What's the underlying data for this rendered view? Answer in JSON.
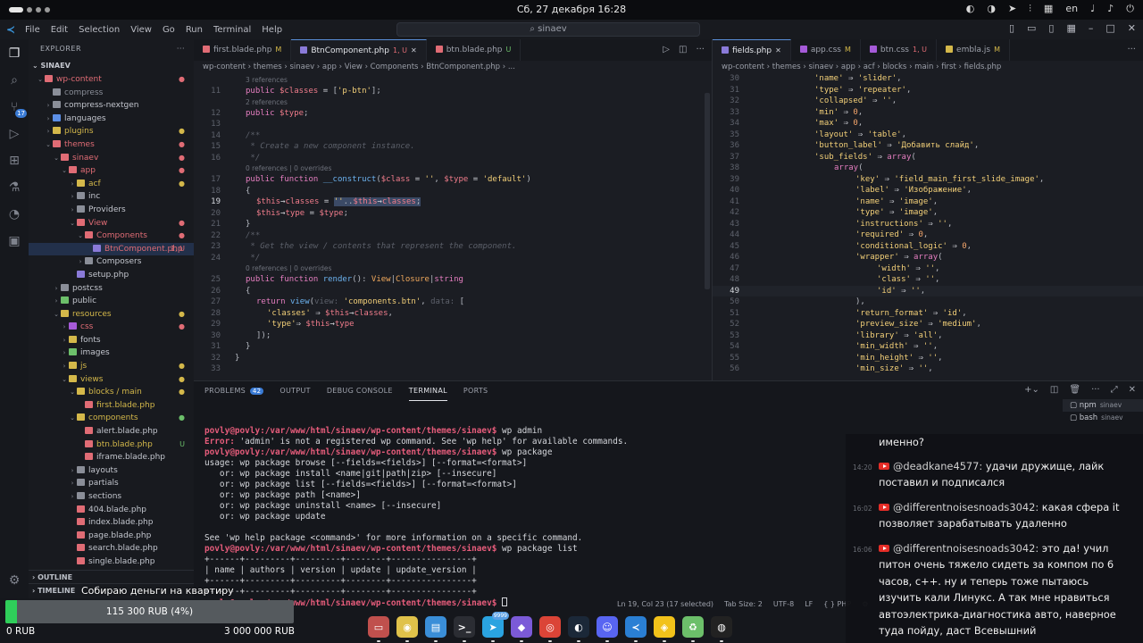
{
  "system_bar": {
    "clock": "Сб, 27 декабря 16:28",
    "lang": "en"
  },
  "titlebar": {
    "menu": [
      "File",
      "Edit",
      "Selection",
      "View",
      "Go",
      "Run",
      "Terminal",
      "Help"
    ],
    "search": "sinaev"
  },
  "explorer": {
    "title": "EXPLORER",
    "root": "SINAEV",
    "items": [
      {
        "label": "wp-content",
        "depth": 0,
        "chev": "v",
        "color": "#e06c75",
        "mark": "●",
        "markColor": "#e06c75",
        "textColor": "#e06c75"
      },
      {
        "label": "compress",
        "depth": 1,
        "chev": "",
        "color": "#8a8e98",
        "mark": "",
        "textColor": "#8a8e98"
      },
      {
        "label": "compress-nextgen",
        "depth": 1,
        "chev": ">",
        "color": "#8a8e98",
        "mark": "",
        "textColor": "#c3c6ce"
      },
      {
        "label": "languages",
        "depth": 1,
        "chev": ">",
        "color": "#5c8fe6",
        "mark": "",
        "textColor": "#c3c6ce"
      },
      {
        "label": "plugins",
        "depth": 1,
        "chev": ">",
        "color": "#d4b84a",
        "mark": "●",
        "markColor": "#d4b84a",
        "textColor": "#d4b84a"
      },
      {
        "label": "themes",
        "depth": 1,
        "chev": "v",
        "color": "#e06c75",
        "mark": "●",
        "markColor": "#e06c75",
        "textColor": "#e06c75"
      },
      {
        "label": "sinaev",
        "depth": 2,
        "chev": "v",
        "color": "#e06c75",
        "mark": "●",
        "markColor": "#e06c75",
        "textColor": "#e06c75"
      },
      {
        "label": "app",
        "depth": 3,
        "chev": "v",
        "color": "#e06c75",
        "mark": "●",
        "markColor": "#e06c75",
        "textColor": "#e06c75"
      },
      {
        "label": "acf",
        "depth": 4,
        "chev": ">",
        "color": "#d4b84a",
        "mark": "●",
        "markColor": "#d4b84a",
        "textColor": "#d4b84a"
      },
      {
        "label": "inc",
        "depth": 4,
        "chev": ">",
        "color": "#8a8e98",
        "mark": "",
        "textColor": "#c3c6ce"
      },
      {
        "label": "Providers",
        "depth": 4,
        "chev": ">",
        "color": "#8a8e98",
        "mark": "",
        "textColor": "#c3c6ce"
      },
      {
        "label": "View",
        "depth": 4,
        "chev": "v",
        "color": "#e06c75",
        "mark": "●",
        "markColor": "#e06c75",
        "textColor": "#e06c75"
      },
      {
        "label": "Components",
        "depth": 5,
        "chev": "v",
        "color": "#e06c75",
        "mark": "●",
        "markColor": "#e06c75",
        "textColor": "#e06c75"
      },
      {
        "label": "BtnComponent.php",
        "depth": 6,
        "chev": "",
        "color": "#8a7ad8",
        "mark": "1, U",
        "markColor": "#e06c75",
        "textColor": "#e06c75",
        "selected": true
      },
      {
        "label": "Composers",
        "depth": 5,
        "chev": ">",
        "color": "#8a8e98",
        "mark": "",
        "textColor": "#c3c6ce"
      },
      {
        "label": "setup.php",
        "depth": 4,
        "chev": "",
        "color": "#8a7ad8",
        "mark": "",
        "textColor": "#c3c6ce"
      },
      {
        "label": "postcss",
        "depth": 2,
        "chev": ">",
        "color": "#8a8e98",
        "mark": "",
        "textColor": "#c3c6ce"
      },
      {
        "label": "public",
        "depth": 2,
        "chev": ">",
        "color": "#6cbf6a",
        "mark": "",
        "textColor": "#c3c6ce"
      },
      {
        "label": "resources",
        "depth": 2,
        "chev": "v",
        "color": "#d4b84a",
        "mark": "●",
        "markColor": "#d4b84a",
        "textColor": "#d4b84a"
      },
      {
        "label": "css",
        "depth": 3,
        "chev": ">",
        "color": "#a55ad8",
        "mark": "●",
        "markColor": "#e06c75",
        "textColor": "#e06c75"
      },
      {
        "label": "fonts",
        "depth": 3,
        "chev": ">",
        "color": "#d4b84a",
        "mark": "",
        "textColor": "#c3c6ce"
      },
      {
        "label": "images",
        "depth": 3,
        "chev": ">",
        "color": "#6cbf6a",
        "mark": "",
        "textColor": "#c3c6ce"
      },
      {
        "label": "js",
        "depth": 3,
        "chev": ">",
        "color": "#d4b84a",
        "mark": "●",
        "markColor": "#d4b84a",
        "textColor": "#d4b84a"
      },
      {
        "label": "views",
        "depth": 3,
        "chev": "v",
        "color": "#d4b84a",
        "mark": "●",
        "markColor": "#d4b84a",
        "textColor": "#d4b84a"
      },
      {
        "label": "blocks / main",
        "depth": 4,
        "chev": "v",
        "color": "#d4b84a",
        "mark": "●",
        "markColor": "#d4b84a",
        "textColor": "#d4b84a"
      },
      {
        "label": "first.blade.php",
        "depth": 5,
        "chev": "",
        "color": "#e06c75",
        "mark": "",
        "textColor": "#d4b84a"
      },
      {
        "label": "components",
        "depth": 4,
        "chev": "v",
        "color": "#d4b84a",
        "mark": "●",
        "markColor": "#6cbf6a",
        "textColor": "#d4b84a"
      },
      {
        "label": "alert.blade.php",
        "depth": 5,
        "chev": "",
        "color": "#e06c75",
        "mark": "",
        "textColor": "#c3c6ce"
      },
      {
        "label": "btn.blade.php",
        "depth": 5,
        "chev": "",
        "color": "#e06c75",
        "mark": "U",
        "markColor": "#6cbf6a",
        "textColor": "#d4b84a"
      },
      {
        "label": "iframe.blade.php",
        "depth": 5,
        "chev": "",
        "color": "#e06c75",
        "mark": "",
        "textColor": "#c3c6ce"
      },
      {
        "label": "layouts",
        "depth": 4,
        "chev": ">",
        "color": "#8a8e98",
        "mark": "",
        "textColor": "#c3c6ce"
      },
      {
        "label": "partials",
        "depth": 4,
        "chev": ">",
        "color": "#8a8e98",
        "mark": "",
        "textColor": "#c3c6ce"
      },
      {
        "label": "sections",
        "depth": 4,
        "chev": ">",
        "color": "#8a8e98",
        "mark": "",
        "textColor": "#c3c6ce"
      },
      {
        "label": "404.blade.php",
        "depth": 4,
        "chev": "",
        "color": "#e06c75",
        "mark": "",
        "textColor": "#c3c6ce"
      },
      {
        "label": "index.blade.php",
        "depth": 4,
        "chev": "",
        "color": "#e06c75",
        "mark": "",
        "textColor": "#c3c6ce"
      },
      {
        "label": "page.blade.php",
        "depth": 4,
        "chev": "",
        "color": "#e06c75",
        "mark": "",
        "textColor": "#c3c6ce"
      },
      {
        "label": "search.blade.php",
        "depth": 4,
        "chev": "",
        "color": "#e06c75",
        "mark": "",
        "textColor": "#c3c6ce"
      },
      {
        "label": "single.blade.php",
        "depth": 4,
        "chev": "",
        "color": "#e06c75",
        "mark": "",
        "textColor": "#c3c6ce"
      }
    ],
    "outline": "OUTLINE",
    "timeline": "TIMELINE"
  },
  "left_editor": {
    "tabs": [
      {
        "label": "first.blade.php",
        "status": "M",
        "color": "#e06c75",
        "statusColor": "#d4b84a",
        "active": false
      },
      {
        "label": "BtnComponent.php",
        "status": "1, U",
        "color": "#8a7ad8",
        "statusColor": "#e06c75",
        "active": true
      },
      {
        "label": "btn.blade.php",
        "status": "U",
        "color": "#e06c75",
        "statusColor": "#6cbf6a",
        "active": false
      }
    ],
    "breadcrumb": "wp-content  ›  themes  ›  sinaev  ›  app  ›  View  ›  Components  ›  BtnComponent.php  ›  ...",
    "hint_refs_3": "3 references",
    "hint_refs_2": "2 references",
    "hint_overrides": "0 references | 0 overrides",
    "cursor_line": "19"
  },
  "right_editor": {
    "tabs": [
      {
        "label": "fields.php",
        "status": "",
        "color": "#8a7ad8",
        "statusColor": "#9ea2ac",
        "active": true
      },
      {
        "label": "app.css",
        "status": "M",
        "color": "#a55ad8",
        "statusColor": "#d4b84a",
        "active": false
      },
      {
        "label": "btn.css",
        "status": "1, U",
        "color": "#a55ad8",
        "statusColor": "#e06c75",
        "active": false
      },
      {
        "label": "embla.js",
        "status": "M",
        "color": "#d4b84a",
        "statusColor": "#d4b84a",
        "active": false
      }
    ],
    "breadcrumb": "wp-content  ›  themes  ›  sinaev  ›  app  ›  acf  ›  blocks  ›  main  ›  first  ›  fields.php",
    "cursor_line": "49"
  },
  "panel": {
    "tabs": [
      "PROBLEMS",
      "OUTPUT",
      "DEBUG CONSOLE",
      "TERMINAL",
      "PORTS"
    ],
    "problems_count": "42",
    "active_tab": "TERMINAL",
    "terminals": [
      {
        "name": "npm",
        "sub": "sinaev"
      },
      {
        "name": "bash",
        "sub": "sinaev"
      }
    ],
    "prompt": "povly@povly:/var/www/html/sinaev/wp-content/themes/sinaev$",
    "lines": [
      {
        "type": "blank",
        "text": ""
      },
      {
        "type": "cmd",
        "text": " wp admin"
      },
      {
        "type": "error",
        "label": "Error:",
        "text": " 'admin' is not a registered wp command. See 'wp help' for available commands."
      },
      {
        "type": "cmd",
        "text": " wp package"
      },
      {
        "type": "out",
        "text": "usage: wp package browse [--fields=<fields>] [--format=<format>]"
      },
      {
        "type": "out",
        "text": "   or: wp package install <name|git|path|zip> [--insecure]"
      },
      {
        "type": "out",
        "text": "   or: wp package list [--fields=<fields>] [--format=<format>]"
      },
      {
        "type": "out",
        "text": "   or: wp package path [<name>]"
      },
      {
        "type": "out",
        "text": "   or: wp package uninstall <name> [--insecure]"
      },
      {
        "type": "out",
        "text": "   or: wp package update"
      },
      {
        "type": "blank",
        "text": ""
      },
      {
        "type": "out",
        "text": "See 'wp help package <command>' for more information on a specific command."
      },
      {
        "type": "cmd",
        "text": " wp package list"
      },
      {
        "type": "out",
        "text": "+------+---------+---------+--------+----------------+"
      },
      {
        "type": "out",
        "text": "| name | authors | version | update | update_version |"
      },
      {
        "type": "out",
        "text": "+------+---------+---------+--------+----------------+"
      },
      {
        "type": "out",
        "text": "+------+---------+---------+--------+----------------+"
      },
      {
        "type": "cmd",
        "text": " "
      }
    ]
  },
  "status_bar": {
    "position": "Ln 19, Col 23 (17 selected)",
    "tab_size": "Tab Size: 2",
    "encoding": "UTF-8",
    "eol": "LF",
    "language": "PHP"
  },
  "donation": {
    "title": "Собираю деньги на квартиру",
    "progress_label": "115 300 RUB (4%)",
    "progress_fraction": 0.04,
    "min_label": "0 RUB",
    "max_label": "3 000 000 RUB"
  },
  "dock": {
    "apps": [
      {
        "name": "files-app-icon",
        "color": "#c0504d",
        "glyph": "▭",
        "badge": ""
      },
      {
        "name": "ring-app-icon",
        "color": "#e0c24a",
        "glyph": "◉",
        "badge": ""
      },
      {
        "name": "store-app-icon",
        "color": "#3a8ed8",
        "glyph": "▤",
        "badge": ""
      },
      {
        "name": "terminal-app-icon",
        "color": "#2b2d33",
        "glyph": ">_",
        "badge": ""
      },
      {
        "name": "telegram-app-icon",
        "color": "#2aa3e0",
        "glyph": "➤",
        "badge": "9999"
      },
      {
        "name": "obsidian-app-icon",
        "color": "#7b5ad8",
        "glyph": "◆",
        "badge": ""
      },
      {
        "name": "chrome-app-icon",
        "color": "#db4437",
        "glyph": "◎",
        "badge": ""
      },
      {
        "name": "steam-app-icon",
        "color": "#1b2838",
        "glyph": "◐",
        "badge": ""
      },
      {
        "name": "discord-app-icon",
        "color": "#5865f2",
        "glyph": "☺",
        "badge": ""
      },
      {
        "name": "vscode-app-icon",
        "color": "#2a7fd4",
        "glyph": "≺",
        "badge": ""
      },
      {
        "name": "bitwig-app-icon",
        "color": "#f2c21a",
        "glyph": "◈",
        "badge": ""
      },
      {
        "name": "trash-app-icon",
        "color": "#6cbf6a",
        "glyph": "♻",
        "badge": ""
      },
      {
        "name": "obs-app-icon",
        "color": "#222222",
        "glyph": "◍",
        "badge": ""
      }
    ]
  },
  "chat": {
    "top_fragment": "именно?",
    "messages": [
      {
        "time": "14:20",
        "author": "@deadkane4577:",
        "text": " удачи дружище, лайк поставил и подписался"
      },
      {
        "time": "16:02",
        "author": "@differentnoisesnoads3042:",
        "text": " какая сфера it позволяет зарабатывать удаленно"
      },
      {
        "time": "16:06",
        "author": "@differentnoisesnoads3042:",
        "text": " это да! учил питон очень тяжело сидеть за компом по 6 часов, с++. ну и теперь тоже пытаюсь изучить кали Линукс. А так мне нравиться автоэлектрика-диагностика авто, наверное туда пойду, даст Всевышний"
      }
    ]
  }
}
